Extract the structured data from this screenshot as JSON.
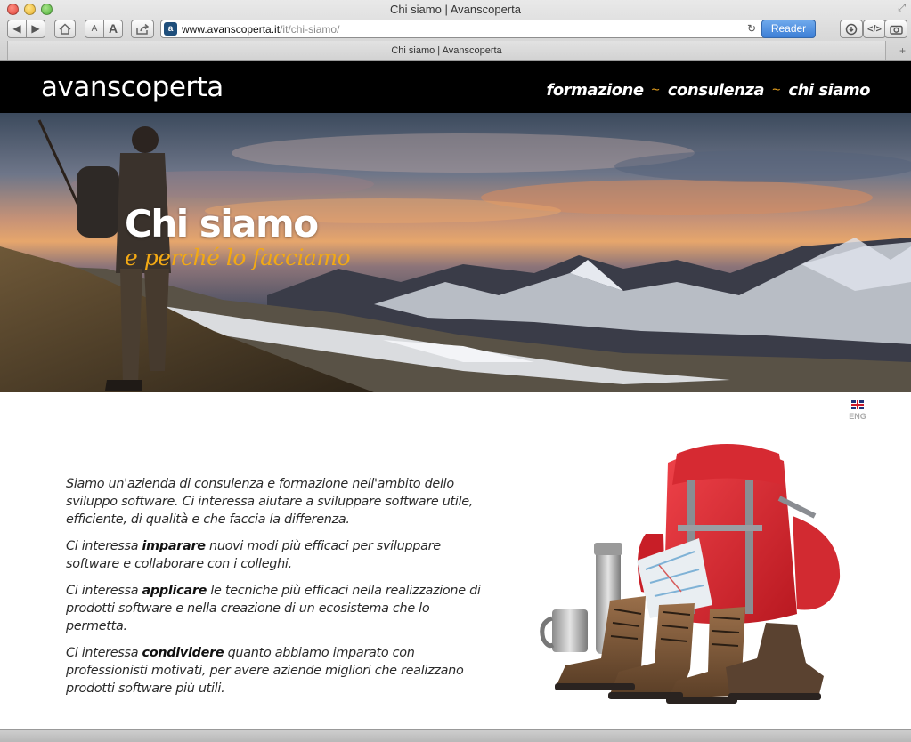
{
  "window": {
    "title": "Chi siamo | Avanscoperta",
    "tab_title": "Chi siamo | Avanscoperta"
  },
  "toolbar": {
    "back_icon": "◀",
    "forward_icon": "▶",
    "font_small": "A",
    "font_large": "A",
    "reader_label": "Reader",
    "url_domain": "www.avanscoperta.it",
    "url_path": "/it/chi-siamo/",
    "favicon_letter": "a"
  },
  "site": {
    "logo": "avanscoperta",
    "nav": [
      {
        "label": "formazione"
      },
      {
        "label": "consulenza"
      },
      {
        "label": "chi siamo"
      }
    ],
    "nav_separator": "~"
  },
  "hero": {
    "title": "Chi siamo",
    "subtitle": "e perché lo facciamo"
  },
  "language": {
    "label": "ENG"
  },
  "content": {
    "p1": "Siamo un'azienda di consulenza e formazione nell'ambito dello sviluppo software. Ci interessa aiutare a sviluppare software utile, efficiente, di qualità e che faccia la differenza.",
    "p2_pre": "Ci interessa ",
    "p2_bold": "imparare",
    "p2_post": " nuovi modi più efficaci per sviluppare software e collaborare con i colleghi.",
    "p3_pre": "Ci interessa ",
    "p3_bold": "applicare",
    "p3_post": " le tecniche più efficaci nella realizzazione di prodotti software e nella creazione di un ecosistema che lo permetta.",
    "p4_pre": "Ci interessa ",
    "p4_bold": "condividere",
    "p4_post": " quanto abbiamo imparato con professionisti motivati, per avere aziende migliori che realizzano prodotti software più utili."
  },
  "colors": {
    "header_bg": "#000000",
    "accent_orange": "#f2a915",
    "reader_blue": "#3d7fd6",
    "backpack_red": "#e0262e"
  }
}
